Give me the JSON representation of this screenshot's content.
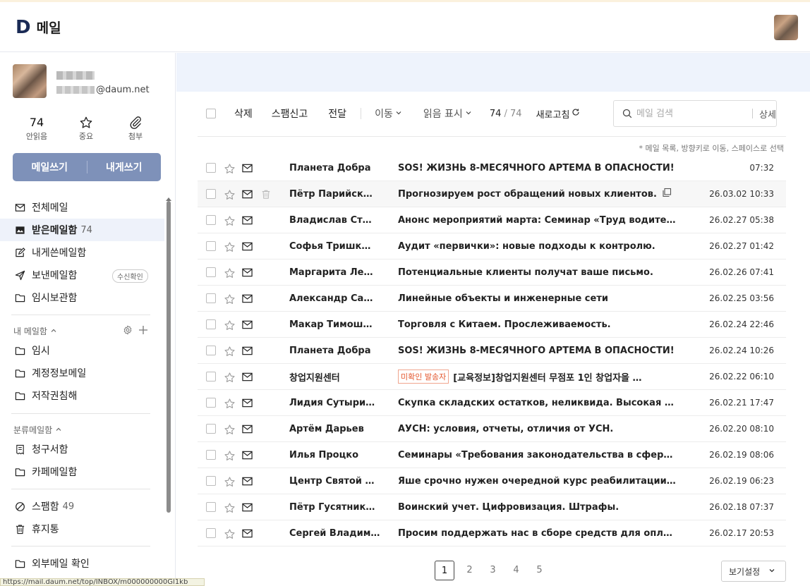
{
  "app": {
    "logo_letter": "D",
    "title": "메일"
  },
  "profile": {
    "email_suffix": "@daum.net"
  },
  "quick": [
    {
      "value": "74",
      "label": "안읽음",
      "icon": ""
    },
    {
      "value": "",
      "label": "중요",
      "icon": "star-icon"
    },
    {
      "value": "",
      "label": "첨부",
      "icon": "paperclip-icon"
    }
  ],
  "compose": {
    "write": "메일쓰기",
    "self": "내게쓰기"
  },
  "folders": {
    "all": "전체메일",
    "inbox": "받은메일함",
    "inbox_count": "74",
    "self_sent": "내게쓴메일함",
    "sent": "보낸메일함",
    "read_receipt": "수신확인",
    "drafts": "임시보관함"
  },
  "my_mailbox": {
    "title": "내 메일함",
    "items": [
      "임시",
      "계정정보메일",
      "저작권침해"
    ]
  },
  "category_mailbox": {
    "title": "분류메일함",
    "items": [
      "청구서함",
      "카페메일함"
    ]
  },
  "spam": {
    "label": "스팸함",
    "count": "49"
  },
  "trash": "휴지통",
  "external": "외부메일 확인",
  "status_url": "https://mail.daum.net/top/INBOX/m000000000Gl1kb",
  "toolbar": {
    "delete": "삭제",
    "spam": "스팸신고",
    "forward": "전달",
    "move": "이동",
    "mark_read": "읽음 표시",
    "count": "74",
    "total": "74",
    "refresh": "새로고침",
    "search_placeholder": "메일 검색",
    "detail": "상세"
  },
  "hint": "* 메일 목록, 방향키로 이동, 스페이스로 선택",
  "emails": [
    {
      "sender": "Планета Добра",
      "subject": "SOS! ЖИЗНЬ 8-МЕСЯЧНОГО АРТЕМА В ОПАСНОСТИ!",
      "date": "07:32",
      "tag": ""
    },
    {
      "sender": "Пётр Парийск…",
      "subject": "Прогнозируем рост обращений новых клиентов.",
      "date": "26.03.02 10:33",
      "tag": ""
    },
    {
      "sender": "Владислав Ст…",
      "subject": "Анонс мероприятий марта: Семинар «Труд водителей…",
      "date": "26.02.27 05:38",
      "tag": ""
    },
    {
      "sender": "Софья Тришк…",
      "subject": "Аудит «первички»: новые подходы к контролю.",
      "date": "26.02.27 01:42",
      "tag": ""
    },
    {
      "sender": "Маргарита Ле…",
      "subject": "Потенциальные клиенты получат ваше письмо.",
      "date": "26.02.26 07:41",
      "tag": ""
    },
    {
      "sender": "Александр Са…",
      "subject": "Линейные объекты и инженерные сети",
      "date": "26.02.25 03:56",
      "tag": ""
    },
    {
      "sender": "Макар Тимош…",
      "subject": "Торговля с Китаем. Прослеживаемость.",
      "date": "26.02.24 22:46",
      "tag": ""
    },
    {
      "sender": "Планета Добра",
      "subject": "SOS! ЖИЗНЬ 8-МЕСЯЧНОГО АРТЕМА В ОПАСНОСТИ!",
      "date": "26.02.24 10:26",
      "tag": ""
    },
    {
      "sender": "창업지원센터",
      "subject": "[교육정보]창업지원센터 무점포 1인 창업자을 …",
      "date": "26.02.22 06:10",
      "tag": "미확인 발송자"
    },
    {
      "sender": "Лидия Сутыри…",
      "subject": "Скупка складских остатков, неликвида. Высокая оцен…",
      "date": "26.02.21 17:47",
      "tag": ""
    },
    {
      "sender": "Артём Дарьев",
      "subject": "АУСН: условия, отчеты, отличия от УСН.",
      "date": "26.02.20 08:10",
      "tag": ""
    },
    {
      "sender": "Илья Процко",
      "subject": "Семинары «Требования законодательства в сфере пр…",
      "date": "26.02.19 08:06",
      "tag": ""
    },
    {
      "sender": "Центр Святой …",
      "subject": "Яше срочно нужен очередной курс реабилитации. По…",
      "date": "26.02.19 06:23",
      "tag": ""
    },
    {
      "sender": "Пётр Гусятник…",
      "subject": "Воинский учет. Цифровизация. Штрафы.",
      "date": "26.02.18 07:37",
      "tag": ""
    },
    {
      "sender": "Сергей Владим…",
      "subject": "Просим поддержать нас в сборе средств для оплаты …",
      "date": "26.02.17 20:53",
      "tag": ""
    }
  ],
  "pagination": {
    "pages": [
      "1",
      "2",
      "3",
      "4",
      "5"
    ],
    "current": "1"
  },
  "view_settings": "보기설정",
  "colors": {
    "compose_bg": "#7e91b9",
    "active_bg": "#eef2fa",
    "banner_bg": "#eef3fc",
    "warning_tag": "#e4572e"
  }
}
